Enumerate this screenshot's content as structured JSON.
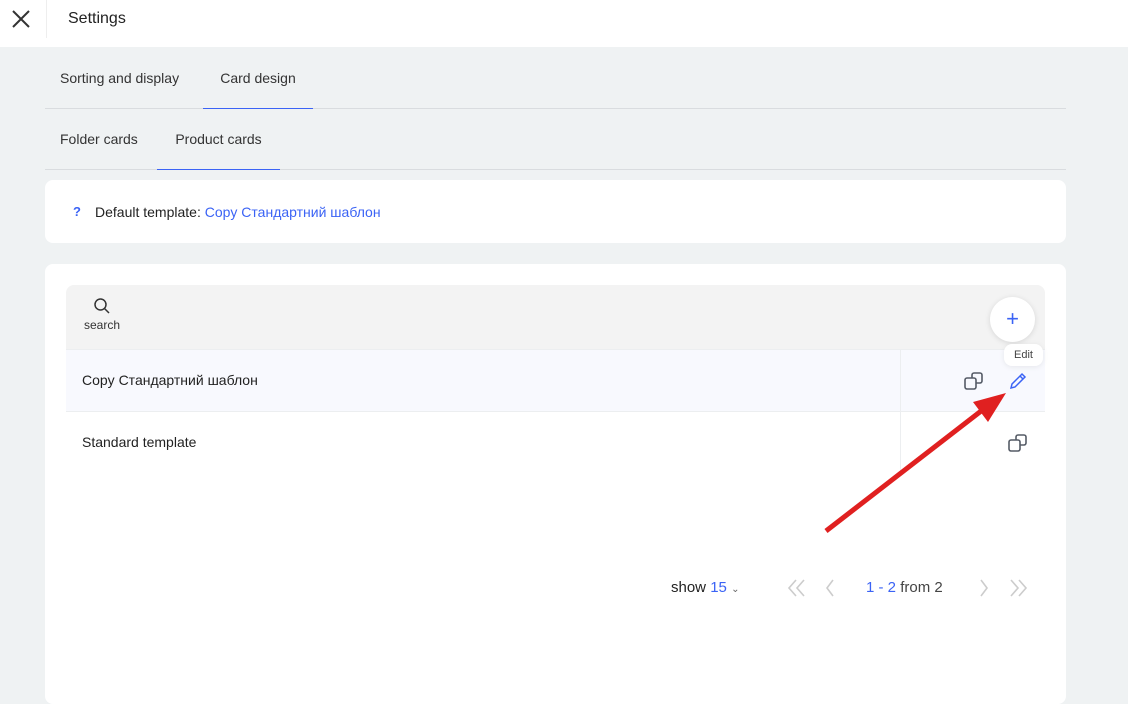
{
  "header": {
    "title": "Settings"
  },
  "tabs": [
    {
      "label": "Sorting and display"
    },
    {
      "label": "Card design"
    }
  ],
  "subtabs": [
    {
      "label": "Folder cards"
    },
    {
      "label": "Product cards"
    }
  ],
  "default_template": {
    "help": "?",
    "label": "Default template:",
    "value": "Copy Стандартний шаблон"
  },
  "search": {
    "label": "search"
  },
  "tooltip": "Edit",
  "rows": [
    {
      "name": "Copy Стандартний шаблон"
    },
    {
      "name": "Standard template"
    }
  ],
  "pager": {
    "show_label": "show",
    "page_size": "15",
    "range": "1 - 2",
    "from_label": "from 2"
  },
  "colors": {
    "accent": "#3b63f5",
    "annotation": "#e02020"
  }
}
